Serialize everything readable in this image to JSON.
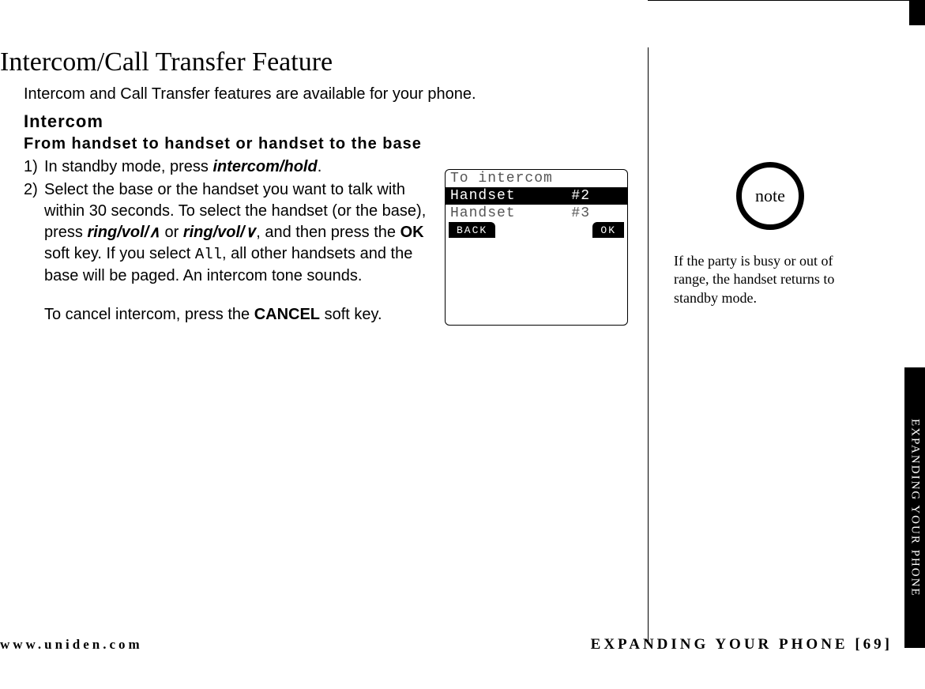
{
  "heading": "Intercom/Call Transfer Feature",
  "intro": "Intercom and Call Transfer features are available for your phone.",
  "sub1": "Intercom",
  "sub2": "From handset to handset or handset to the base",
  "steps": {
    "s1": {
      "num": "1)",
      "a": "In standby mode, press ",
      "key1": "intercom/hold",
      "b": "."
    },
    "s2": {
      "num": "2)",
      "a": "Select the base or the handset you want to talk with within 30 seconds. To select the handset (or the base), press ",
      "key1": "ring/vol/",
      "up": "∧",
      "or": " or ",
      "key2": "ring/vol/",
      "down": "∨",
      "b": ", and then press the ",
      "ok": "OK",
      "c": " soft key. If you select ",
      "all": "All",
      "d": ", all other handsets and the base will be paged. An intercom tone sounds."
    }
  },
  "cancel": {
    "a": "To cancel intercom, press the ",
    "key": "CANCEL",
    "b": " soft key."
  },
  "lcd": {
    "title": "To intercom     ",
    "row_sel": "Handset      #2 ",
    "row2": "Handset      #3 ",
    "soft_left": "BACK",
    "soft_right": "OK"
  },
  "note": {
    "label": "note",
    "text": "If the party is busy or out of range, the handset returns to standby mode."
  },
  "footer": {
    "url": "www.uniden.com",
    "section": "EXPANDING YOUR PHONE",
    "page": "[69]"
  },
  "side_tab": "EXPANDING YOUR PHONE"
}
